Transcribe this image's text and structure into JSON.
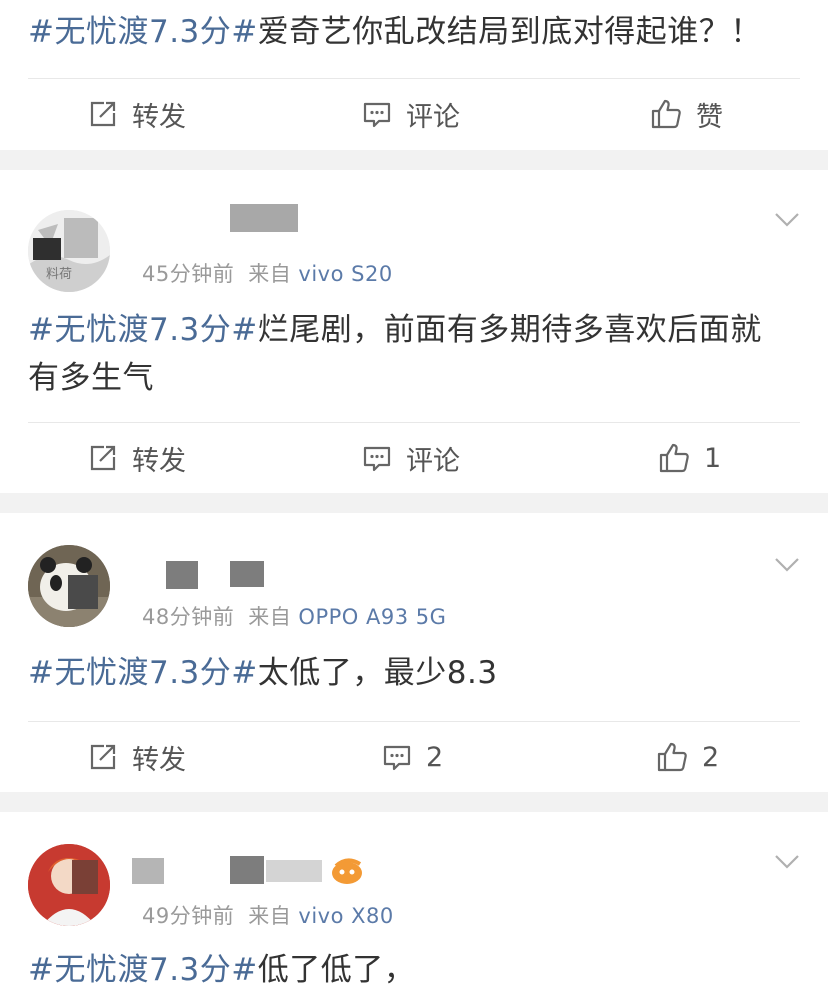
{
  "hashtag": "#无忧渡7.3分#",
  "posts": [
    {
      "text": "爱奇艺你乱改结局到底对得起谁？！",
      "actions": {
        "repost": "转发",
        "comment": "评论",
        "like": "赞"
      }
    },
    {
      "time": "45分钟前",
      "source_prefix": "来自",
      "device": "vivo S20",
      "text": "烂尾剧，前面有多期待多喜欢后面就有多生气",
      "actions": {
        "repost": "转发",
        "comment": "评论",
        "like": "1"
      }
    },
    {
      "time": "48分钟前",
      "source_prefix": "来自",
      "device": "OPPO A93 5G",
      "text": "太低了，最少8.3",
      "actions": {
        "repost": "转发",
        "comment": "2",
        "like": "2"
      }
    },
    {
      "time": "49分钟前",
      "source_prefix": "来自",
      "device": "vivo X80",
      "text": "低了低了，"
    }
  ],
  "icons": {
    "repost": "repost-icon",
    "comment": "comment-icon",
    "like": "thumbs-up-icon",
    "more": "chevron-down-icon"
  },
  "colors": {
    "hashtag": "#4a6b96",
    "device": "#5b7aa8",
    "meta": "#9a9a9a",
    "separator": "#f2f2f2"
  }
}
